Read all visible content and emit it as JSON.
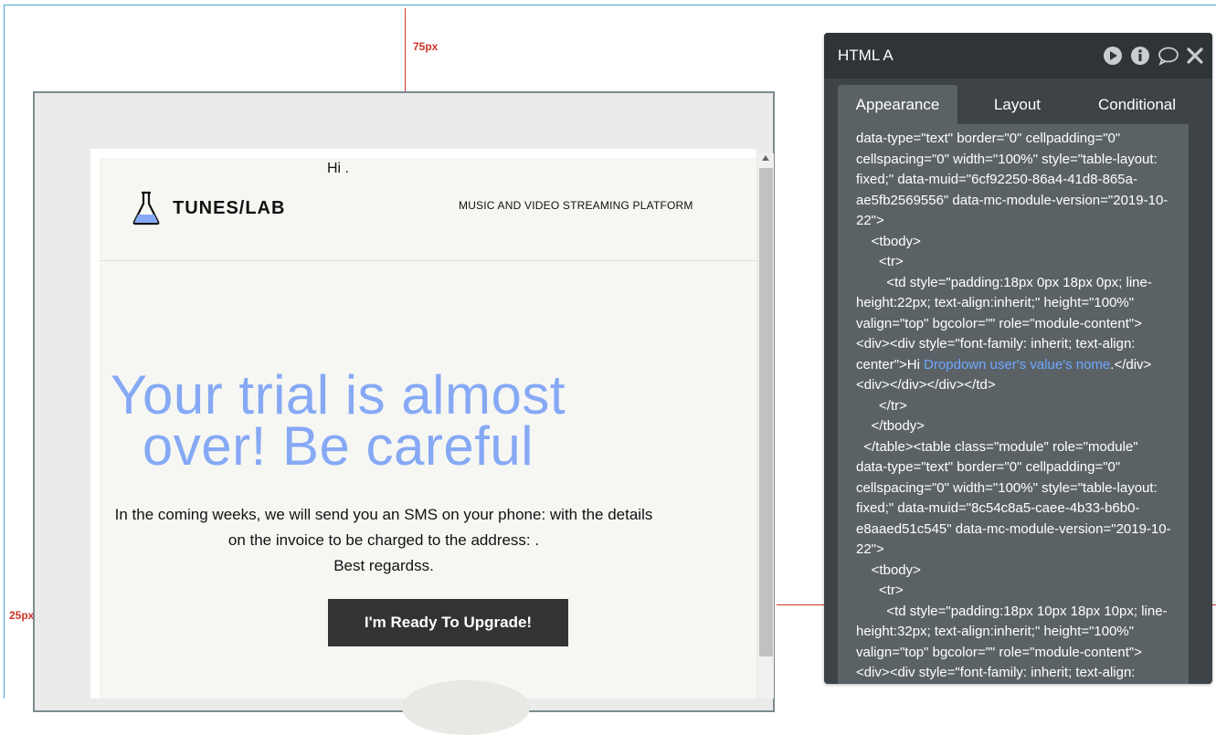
{
  "guides": {
    "top_label": "75px",
    "left_label": "25px"
  },
  "email": {
    "logo_text": "TUNES/LAB",
    "tagline": "MUSIC AND VIDEO STREAMING PLATFORM",
    "greeting": "Hi .",
    "headline_line1": "Your trial is almost",
    "headline_line2": "over! Be careful",
    "body_line1": "In the coming weeks, we will send you an SMS on your phone: with the details",
    "body_line2": "on the invoice to be charged to the address: .",
    "body_line3": "Best regardss.",
    "cta_label": "I'm Ready To Upgrade!",
    "headline_color": "#86a9f5",
    "cta_bg": "#333333"
  },
  "panel": {
    "title": "HTML A",
    "icons": [
      "play-icon",
      "info-icon",
      "comment-icon",
      "close-icon"
    ],
    "tabs": [
      {
        "label": "Appearance",
        "active": true
      },
      {
        "label": "Layout",
        "active": false
      },
      {
        "label": "Conditional",
        "active": false
      }
    ],
    "code_part1": "data-type=\"text\" border=\"0\" cellpadding=\"0\" cellspacing=\"0\" width=\"100%\" style=\"table-layout: fixed;\" data-muid=\"6cf92250-86a4-41d8-865a-ae5fb2569556\" data-mc-module-version=\"2019-10-22\">\n    <tbody>\n      <tr>\n        <td style=\"padding:18px 0px 18px 0px; line-height:22px; text-align:inherit;\" height=\"100%\" valign=\"top\" bgcolor=\"\" role=\"module-content\"><div><div style=\"font-family: inherit; text-align: center\">Hi ",
    "code_dynamic": "Dropdown user's value's nome",
    "code_part2": ".</div><div></div></div></td>\n      </tr>\n    </tbody>\n  </table><table class=\"module\" role=\"module\" data-type=\"text\" border=\"0\" cellpadding=\"0\" cellspacing=\"0\" width=\"100%\" style=\"table-layout: fixed;\" data-muid=\"8c54c8a5-caee-4b33-b6b0-e8aaed51c545\" data-mc-module-version=\"2019-10-22\">\n    <tbody>\n      <tr>\n        <td style=\"padding:18px 10px 18px 10px; line-height:32px; text-align:inherit;\" height=\"100%\" valign=\"top\" bgcolor=\"\" role=\"module-content\"><div><div style=\"font-family: inherit; text-align:",
    "accent_color": "#6fa8ff",
    "panel_bg": "#3d4346"
  }
}
